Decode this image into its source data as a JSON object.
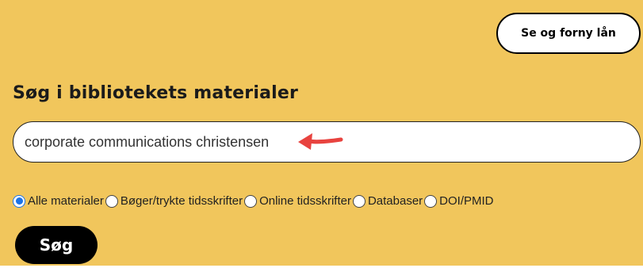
{
  "header": {
    "renew_button_label": "Se og forny lån"
  },
  "search": {
    "heading": "Søg i bibliotekets materialer",
    "query": "corporate communications christensen",
    "submit_label": "Søg"
  },
  "filters": [
    {
      "label": "Alle materialer",
      "checked": true
    },
    {
      "label": "Bøger/trykte tidsskrifter",
      "checked": false
    },
    {
      "label": "Online tidsskrifter",
      "checked": false
    },
    {
      "label": "Databaser",
      "checked": false
    },
    {
      "label": "DOI/PMID",
      "checked": false
    }
  ],
  "colors": {
    "panel_background": "#f1c65c",
    "annotation_arrow": "#e8433f",
    "radio_accent": "#1a73e8"
  },
  "annotation": {
    "icon": "red-arrow-icon"
  }
}
